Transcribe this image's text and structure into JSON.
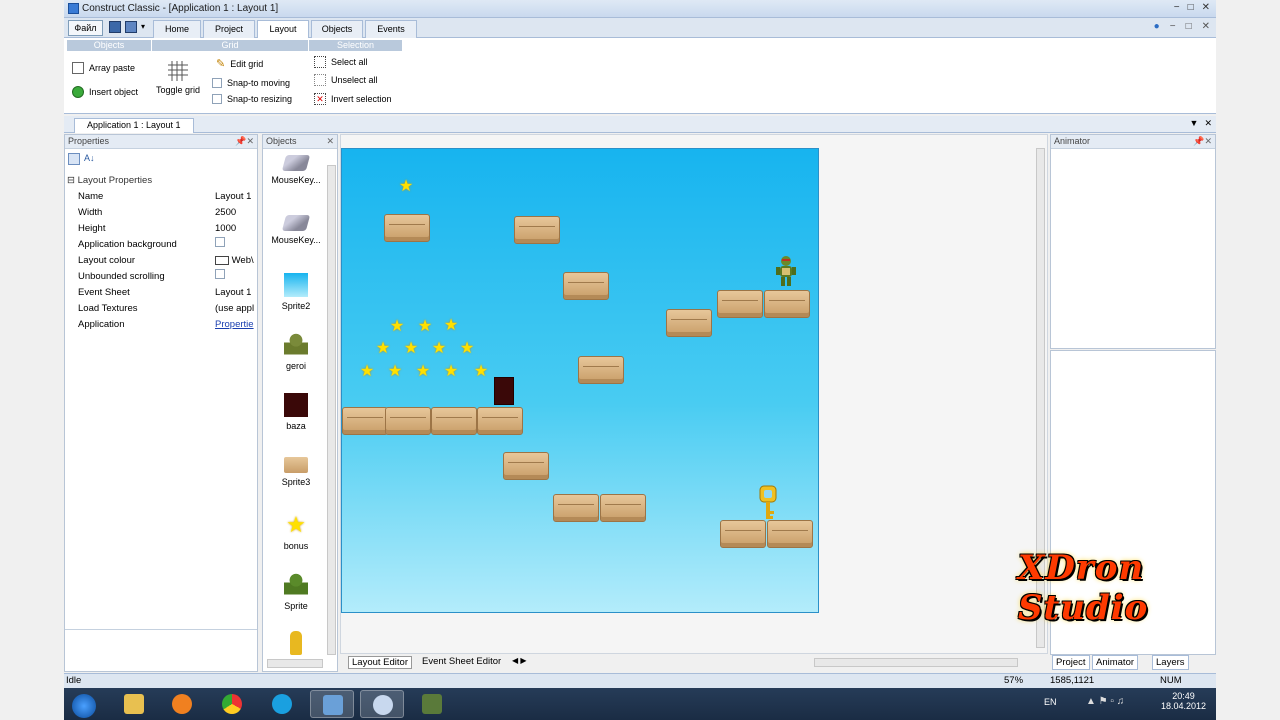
{
  "window": {
    "title": "Construct Classic - [Application 1 : Layout 1]"
  },
  "ribbon": {
    "file_label": "Файл",
    "tabs": [
      "Home",
      "Project",
      "Layout",
      "Objects",
      "Events"
    ],
    "active_tab": "Layout",
    "groups": [
      "Objects",
      "Grid",
      "Selection"
    ],
    "objects_group": {
      "array_paste": "Array paste",
      "insert_object": "Insert object"
    },
    "grid_group": {
      "toggle_grid": "Toggle grid",
      "edit_grid": "Edit grid",
      "snap_moving": "Snap-to moving",
      "snap_resizing": "Snap-to resizing"
    },
    "selection_group": {
      "select_all": "Select all",
      "unselect_all": "Unselect all",
      "invert_selection": "Invert selection"
    }
  },
  "document_tab": "Application 1 : Layout 1",
  "properties": {
    "header": "Properties",
    "section": "Layout Properties",
    "rows": [
      {
        "key": "Name",
        "value": "Layout 1"
      },
      {
        "key": "Width",
        "value": "2500"
      },
      {
        "key": "Height",
        "value": "1000"
      },
      {
        "key": "Application background",
        "value": ""
      },
      {
        "key": "Layout colour",
        "value": "Web\\"
      },
      {
        "key": "Unbounded scrolling",
        "value": ""
      },
      {
        "key": "Event Sheet",
        "value": "Layout 1"
      },
      {
        "key": "Load Textures",
        "value": "(use appl"
      },
      {
        "key": "Application",
        "value": "Propertie"
      }
    ]
  },
  "objects_panel": {
    "header": "Objects",
    "items": [
      "MouseKey...",
      "MouseKey...",
      "Sprite2",
      "geroi",
      "baza",
      "Sprite3",
      "bonus",
      "Sprite",
      ""
    ]
  },
  "animator_panel": {
    "header": "Animator"
  },
  "bottom_tabs": [
    "Layout Editor",
    "Event Sheet Editor"
  ],
  "right_bottom_tabs": [
    "Project",
    "Animator",
    "Layers"
  ],
  "watermark": {
    "line1": "XDron",
    "line2": "Studio"
  },
  "status": {
    "text": "Idle",
    "zoom": "57%",
    "coords": "1585,1121",
    "num": "NUM"
  },
  "taskbar": {
    "lang": "EN",
    "time": "20:49",
    "date": "18.04.2012"
  }
}
